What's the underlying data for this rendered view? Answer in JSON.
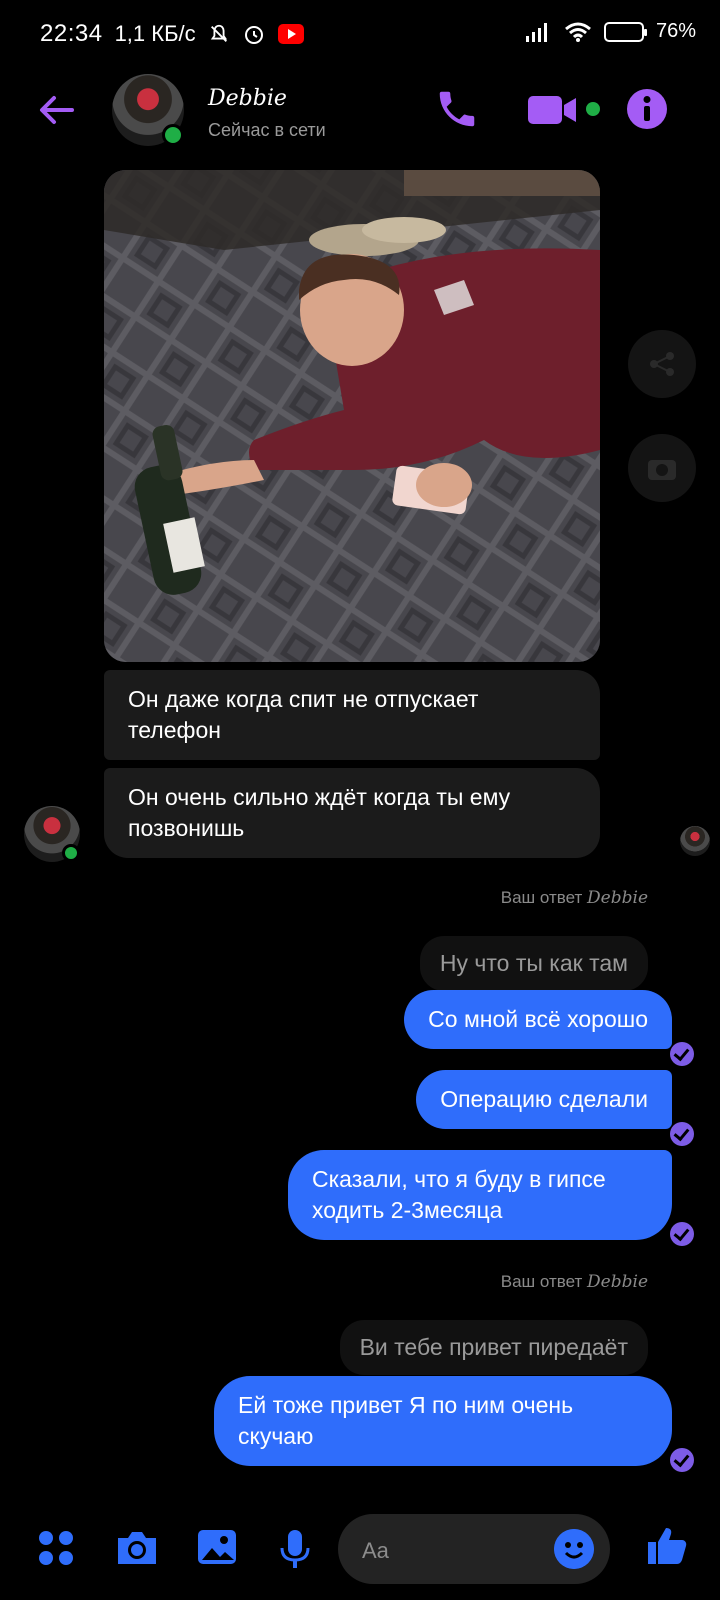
{
  "status_bar": {
    "time": "22:34",
    "speed": "1,1 КБ/с",
    "battery": "76%",
    "battery_fraction": 0.76
  },
  "header": {
    "name": "Debbie",
    "status": "Сейчас в сети"
  },
  "photo": {
    "description_icon": "photo-message"
  },
  "incoming": [
    {
      "text": "Он даже когда спит не отпускает телефон"
    },
    {
      "text": "Он очень сильно ждёт когда ты ему позвонишь"
    }
  ],
  "replies": [
    {
      "label": "Ваш ответ",
      "name": "Debbie",
      "quoted": "Ну что ты как там"
    },
    {
      "label": "Ваш ответ",
      "name": "Debbie",
      "quoted": "Ви тебе привет пиредаёт"
    }
  ],
  "outgoing": [
    {
      "text": "Со мной всё хорошо"
    },
    {
      "text": "Операцию сделали"
    },
    {
      "text": "Сказали, что я буду в гипсе ходить 2-3месяца"
    },
    {
      "text": "Ей тоже привет Я по ним очень скучаю"
    }
  ],
  "composer": {
    "placeholder": "Aa"
  },
  "colors": {
    "accent": "#a45cf5",
    "outgoing_bubble": "#2f6dfb",
    "incoming_bubble": "#1b1b1b",
    "online": "#1fae46"
  }
}
